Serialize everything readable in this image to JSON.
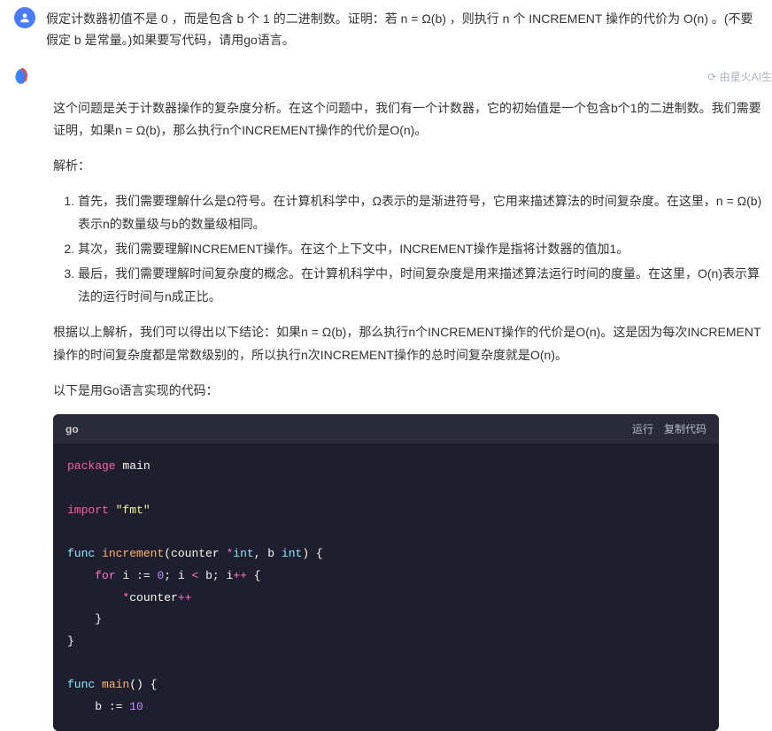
{
  "user": {
    "text": "假定计数器初值不是 0 ，而是包含 b 个 1 的二进制数。证明：若 n = Ω(b) ，则执行 n 个 INCREMENT 操作的代价为 O(n) 。(不要假定 b 是常量。)如果要写代码，请用go语言。"
  },
  "ai": {
    "badge": "⟳ 由星火AI生",
    "p1": "这个问题是关于计数器操作的复杂度分析。在这个问题中，我们有一个计数器，它的初始值是一个包含b个1的二进制数。我们需要证明，如果n = Ω(b)，那么执行n个INCREMENT操作的代价是O(n)。",
    "p2": "解析：",
    "li1": "首先，我们需要理解什么是Ω符号。在计算机科学中，Ω表示的是渐进符号，它用来描述算法的时间复杂度。在这里，n = Ω(b)表示n的数量级与b的数量级相同。",
    "li2": "其次，我们需要理解INCREMENT操作。在这个上下文中，INCREMENT操作是指将计数器的值加1。",
    "li3": "最后，我们需要理解时间复杂度的概念。在计算机科学中，时间复杂度是用来描述算法运行时间的度量。在这里，O(n)表示算法的运行时间与n成正比。",
    "p3": "根据以上解析，我们可以得出以下结论：如果n = Ω(b)，那么执行n个INCREMENT操作的代价是O(n)。这是因为每次INCREMENT操作的时间复杂度都是常数级别的，所以执行n次INCREMENT操作的总时间复杂度就是O(n)。",
    "p4": "以下是用Go语言实现的代码："
  },
  "code": {
    "lang": "go",
    "run": "运行",
    "copy": "复制代码",
    "kw_package": "package",
    "pkg_main": "main",
    "kw_import": "import",
    "str_fmt": "\"fmt\"",
    "kw_func": "func",
    "fn_increment": "increment",
    "sig_open": "(counter ",
    "star": "*",
    "type_int": "int",
    "sig_mid": ", b ",
    "sig_close": ") {",
    "kw_for": "for",
    "for_init": " i := ",
    "num_0": "0",
    "for_sep1": "; i ",
    "op_lt": "<",
    "for_sep2": " b; i",
    "op_pp": "++",
    "brace_open": " {",
    "body_star": "*",
    "body_counter": "counter",
    "body_pp": "++",
    "brace_close": "}",
    "fn_main": "main",
    "main_sig": "() {",
    "main_b": "b := ",
    "num_10": "10"
  }
}
